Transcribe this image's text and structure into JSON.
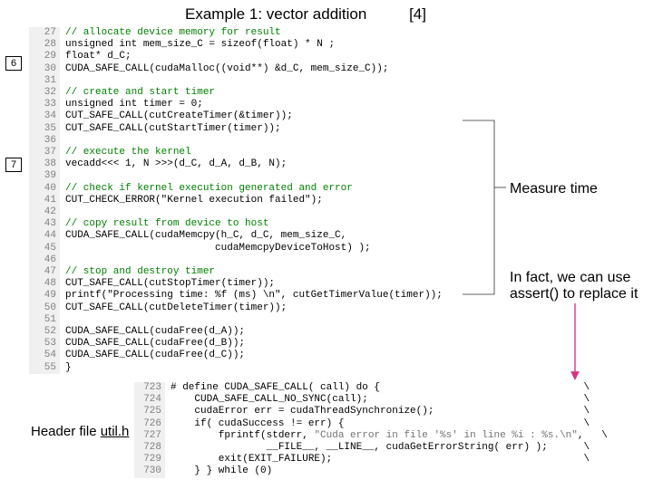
{
  "title": {
    "main": "Example 1: vector addition",
    "index": "[4]"
  },
  "callouts": {
    "a": "6",
    "b": "7"
  },
  "main_code": [
    {
      "n": 27,
      "cls": "cmt",
      "t": "// allocate device memory for result"
    },
    {
      "n": 28,
      "cls": "",
      "t": "unsigned int mem_size_C = sizeof(float) * N ;"
    },
    {
      "n": 29,
      "cls": "",
      "t": "float* d_C;"
    },
    {
      "n": 30,
      "cls": "",
      "t": "CUDA_SAFE_CALL(cudaMalloc((void**) &d_C, mem_size_C));"
    },
    {
      "n": 31,
      "cls": "",
      "t": ""
    },
    {
      "n": 32,
      "cls": "cmt",
      "t": "// create and start timer"
    },
    {
      "n": 33,
      "cls": "",
      "t": "unsigned int timer = 0;"
    },
    {
      "n": 34,
      "cls": "",
      "t": "CUT_SAFE_CALL(cutCreateTimer(&timer));"
    },
    {
      "n": 35,
      "cls": "",
      "t": "CUT_SAFE_CALL(cutStartTimer(timer));"
    },
    {
      "n": 36,
      "cls": "",
      "t": ""
    },
    {
      "n": 37,
      "cls": "cmt",
      "t": "// execute the kernel"
    },
    {
      "n": 38,
      "cls": "",
      "t": "vecadd<<< 1, N >>>(d_C, d_A, d_B, N);"
    },
    {
      "n": 39,
      "cls": "",
      "t": ""
    },
    {
      "n": 40,
      "cls": "cmt",
      "t": "// check if kernel execution generated and error"
    },
    {
      "n": 41,
      "cls": "",
      "t": "CUT_CHECK_ERROR(\"Kernel execution failed\");"
    },
    {
      "n": 42,
      "cls": "",
      "t": ""
    },
    {
      "n": 43,
      "cls": "cmt",
      "t": "// copy result from device to host"
    },
    {
      "n": 44,
      "cls": "",
      "t": "CUDA_SAFE_CALL(cudaMemcpy(h_C, d_C, mem_size_C,"
    },
    {
      "n": 45,
      "cls": "",
      "t": "                         cudaMemcpyDeviceToHost) );"
    },
    {
      "n": 46,
      "cls": "",
      "t": ""
    },
    {
      "n": 47,
      "cls": "cmt",
      "t": "// stop and destroy timer"
    },
    {
      "n": 48,
      "cls": "",
      "t": "CUT_SAFE_CALL(cutStopTimer(timer));"
    },
    {
      "n": 49,
      "cls": "",
      "t": "printf(\"Processing time: %f (ms) \\n\", cutGetTimerValue(timer));"
    },
    {
      "n": 50,
      "cls": "",
      "t": "CUT_SAFE_CALL(cutDeleteTimer(timer));"
    },
    {
      "n": 51,
      "cls": "",
      "t": ""
    },
    {
      "n": 52,
      "cls": "",
      "t": "CUDA_SAFE_CALL(cudaFree(d_A));"
    },
    {
      "n": 53,
      "cls": "",
      "t": "CUDA_SAFE_CALL(cudaFree(d_B));"
    },
    {
      "n": 54,
      "cls": "",
      "t": "CUDA_SAFE_CALL(cudaFree(d_C));"
    },
    {
      "n": 55,
      "cls": "",
      "t": "}"
    }
  ],
  "macro_code": [
    {
      "n": 723,
      "t": "# define CUDA_SAFE_CALL( call) do {                                  \\",
      "str": ""
    },
    {
      "n": 724,
      "t": "    CUDA_SAFE_CALL_NO_SYNC(call);                                    \\",
      "str": ""
    },
    {
      "n": 725,
      "t": "    cudaError err = cudaThreadSynchronize();                         \\",
      "str": ""
    },
    {
      "n": 726,
      "t": "    if( cudaSuccess != err) {                                        \\",
      "str": ""
    },
    {
      "n": 727,
      "t": "        fprintf(stderr, ",
      "str": "\"Cuda error in file '%s' in line %i : %s.\\n\""
    },
    {
      "n": 728,
      "t": "                __FILE__, __LINE__, cudaGetErrorString( err) );      \\",
      "str": ""
    },
    {
      "n": 729,
      "t": "        exit(EXIT_FAILURE);                                          \\",
      "str": ""
    },
    {
      "n": 730,
      "t": "    } } while (0)",
      "str": ""
    }
  ],
  "annotations": {
    "measure": "Measure time",
    "assert_line1": "In fact, we can use",
    "assert_line2": "assert() to replace it"
  },
  "footer": {
    "prefix": "Header file ",
    "file": "util.h"
  }
}
